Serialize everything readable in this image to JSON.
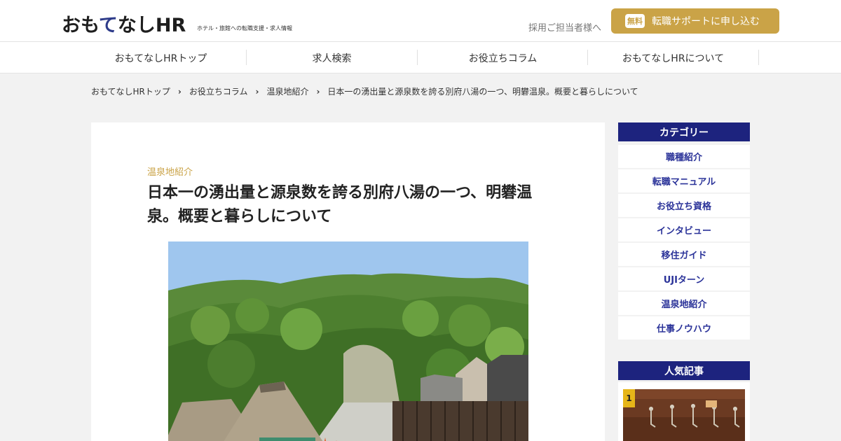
{
  "header": {
    "logo_part1": "おも",
    "logo_part2": "て",
    "logo_part3": "なしHR",
    "tagline": "ホテル・旅館への転職支援・求人情報",
    "recruiter_link": "採用ご担当者様へ",
    "cta_badge": "無料",
    "cta_label": "転職サポートに申し込む"
  },
  "nav": {
    "items": [
      "おもてなしHRトップ",
      "求人検索",
      "お役立ちコラム",
      "おもてなしHRについて"
    ]
  },
  "breadcrumb": {
    "items": [
      "おもてなしHRトップ",
      "お役立ちコラム",
      "温泉地紹介",
      "日本一の湧出量と源泉数を誇る別府八湯の一つ、明礬温泉。概要と暮らしについて"
    ]
  },
  "article": {
    "category": "温泉地紹介",
    "title": "日本一の湧出量と源泉数を誇る別府八湯の一つ、明礬温泉。概要と暮らしについて"
  },
  "sidebar": {
    "category_heading": "カテゴリー",
    "categories": [
      "職種紹介",
      "転職マニュアル",
      "お役立ち資格",
      "インタビュー",
      "移住ガイド",
      "UJIターン",
      "温泉地紹介",
      "仕事ノウハウ"
    ],
    "popular_heading": "人気記事",
    "popular_rank": "1"
  },
  "colors": {
    "accent_gold": "#caa347",
    "navy": "#1d237e",
    "link_blue": "#2b3399",
    "rank_yellow": "#e6b619"
  }
}
